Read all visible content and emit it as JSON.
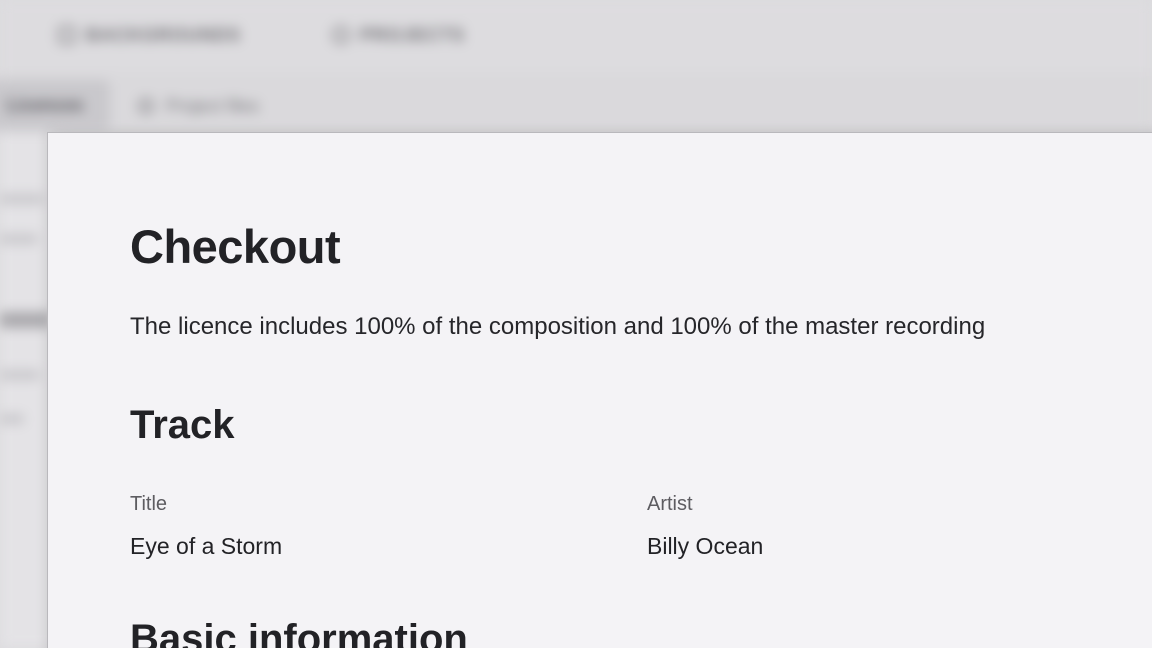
{
  "background": {
    "nav_items": [
      "BACKGROUNDS",
      "PROJECTS"
    ],
    "active_tab": "Licences",
    "tab": "Project files"
  },
  "modal": {
    "title": "Checkout",
    "intro": "The licence includes 100% of the composition and 100% of the master recording",
    "track_section": {
      "heading": "Track",
      "fields": [
        {
          "label": "Title",
          "value": "Eye of a Storm"
        },
        {
          "label": "Artist",
          "value": "Billy Ocean"
        }
      ]
    },
    "basic_info_section": {
      "heading": "Basic information"
    }
  },
  "colors": {
    "panel": "#f4f3f6",
    "backdrop": "#dcdbde",
    "text": "#222226",
    "label": "#5d5c61"
  }
}
